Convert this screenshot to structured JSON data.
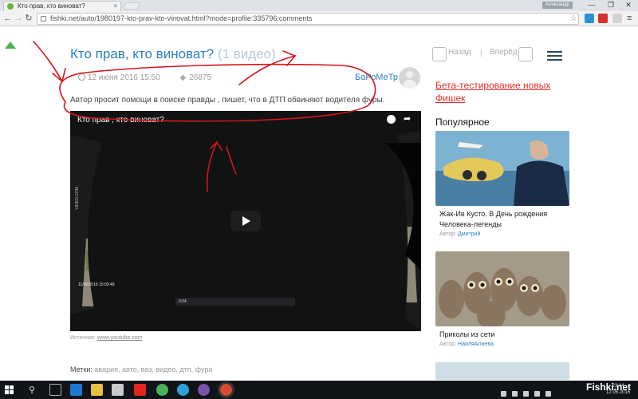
{
  "browser": {
    "tab_title": "Кто прав, кто виноват?",
    "tab_close": "×",
    "user_badge": "Александр",
    "window_minimize": "—",
    "window_maximize": "❐",
    "window_close": "✕",
    "back": "←",
    "forward": "→",
    "reload": "↻",
    "url": "fishki.net/auto/1980197-kto-prav-kto-vinovat.html?mode=profile:335796:comments",
    "bookmark_star": "☆",
    "menu": "≡"
  },
  "article": {
    "title": "Кто прав, кто виноват?",
    "video_count": "(1 видео)",
    "date": "12 июня 2016 15:50",
    "views": "26875",
    "views_icon": "eye-icon",
    "author": "БаРоМеТр",
    "lead": "Автор просит помощи в поиске правды , пишет, что в ДТП обвиняют водителя фуры.",
    "video": {
      "title": "Кто прав , кто виноват?",
      "share_glyph": "➦",
      "timestamp": "11/06/2016 15:03:49",
      "watermark": "VIDEO.COM",
      "player_time": "0:04"
    },
    "source_label": "Источник:",
    "source_link": "www.youtube.com",
    "tags_label": "Метки:",
    "tags": "авария, авто, ваз, видео, дтп, фура"
  },
  "sidebar": {
    "prev_label": "Назад",
    "next_label": "Вперёд",
    "separator": "|",
    "promo": "Бета-тестирование новых Фишек",
    "popular_heading": "Популярное",
    "cards": [
      {
        "title": "Жак-Ив Кусто. В День рождения Человека-легенды",
        "author_label": "Автор:",
        "author": "Дмитрий"
      },
      {
        "title": "Приколы из сети",
        "author_label": "Автор:",
        "author": "НаиляАлиева"
      }
    ]
  },
  "watermark": "Fishki.net",
  "taskbar": {
    "search_glyph": "⚲",
    "clock_time": "23:44",
    "clock_date": "12.06.2016"
  },
  "colors": {
    "link": "#2a7fc0",
    "promo": "#e12f28",
    "annotation_red": "#d4151b",
    "scroll_green": "#4db04a"
  }
}
